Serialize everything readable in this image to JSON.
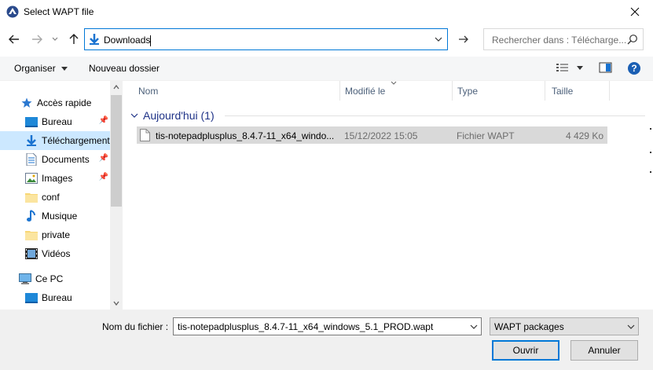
{
  "window": {
    "title": "Select WAPT file"
  },
  "nav": {
    "address": "Downloads",
    "search_placeholder": "Rechercher dans : Télécharge..."
  },
  "toolbar": {
    "organize": "Organiser",
    "new_folder": "Nouveau dossier"
  },
  "sidebar": {
    "quick_access": "Accès rapide",
    "items": [
      {
        "label": "Bureau",
        "icon": "desktop-icon",
        "pinned": true
      },
      {
        "label": "Téléchargements",
        "icon": "download-icon",
        "pinned": true,
        "selected": true
      },
      {
        "label": "Documents",
        "icon": "document-icon",
        "pinned": true
      },
      {
        "label": "Images",
        "icon": "image-icon",
        "pinned": true
      },
      {
        "label": "conf",
        "icon": "folder-icon",
        "pinned": false
      },
      {
        "label": "Musique",
        "icon": "music-icon",
        "pinned": false
      },
      {
        "label": "private",
        "icon": "folder-icon",
        "pinned": false
      },
      {
        "label": "Vidéos",
        "icon": "video-icon",
        "pinned": false
      }
    ],
    "this_pc": "Ce PC",
    "pc_items": [
      {
        "label": "Bureau",
        "icon": "desktop-icon"
      }
    ]
  },
  "columns": {
    "name": "Nom",
    "modified": "Modifié le",
    "type": "Type",
    "size": "Taille"
  },
  "group": {
    "label": "Aujourd'hui (1)"
  },
  "files": [
    {
      "name": "tis-notepadplusplus_8.4.7-11_x64_windo...",
      "modified": "15/12/2022 15:05",
      "type": "Fichier WAPT",
      "size": "4 429 Ko"
    }
  ],
  "footer": {
    "filename_label": "Nom du fichier :",
    "filename_value": "tis-notepadplusplus_8.4.7-11_x64_windows_5.1_PROD.wapt",
    "filetype": "WAPT packages",
    "open": "Ouvrir",
    "cancel": "Annuler"
  }
}
